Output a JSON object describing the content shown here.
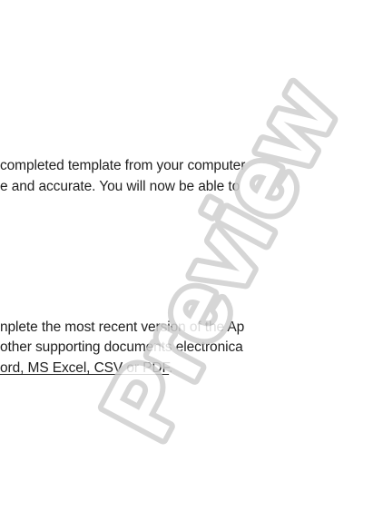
{
  "document": {
    "lines": [
      "completed template from your computer",
      "e and accurate. You will now be able to",
      "nplete the most recent version of the Ap",
      "other supporting documents electronica"
    ],
    "formats_link": "ord, MS Excel, CSV or PDF",
    "formats_suffix": "."
  },
  "watermark": {
    "text": "Preview",
    "color": "#cfcfcf"
  }
}
